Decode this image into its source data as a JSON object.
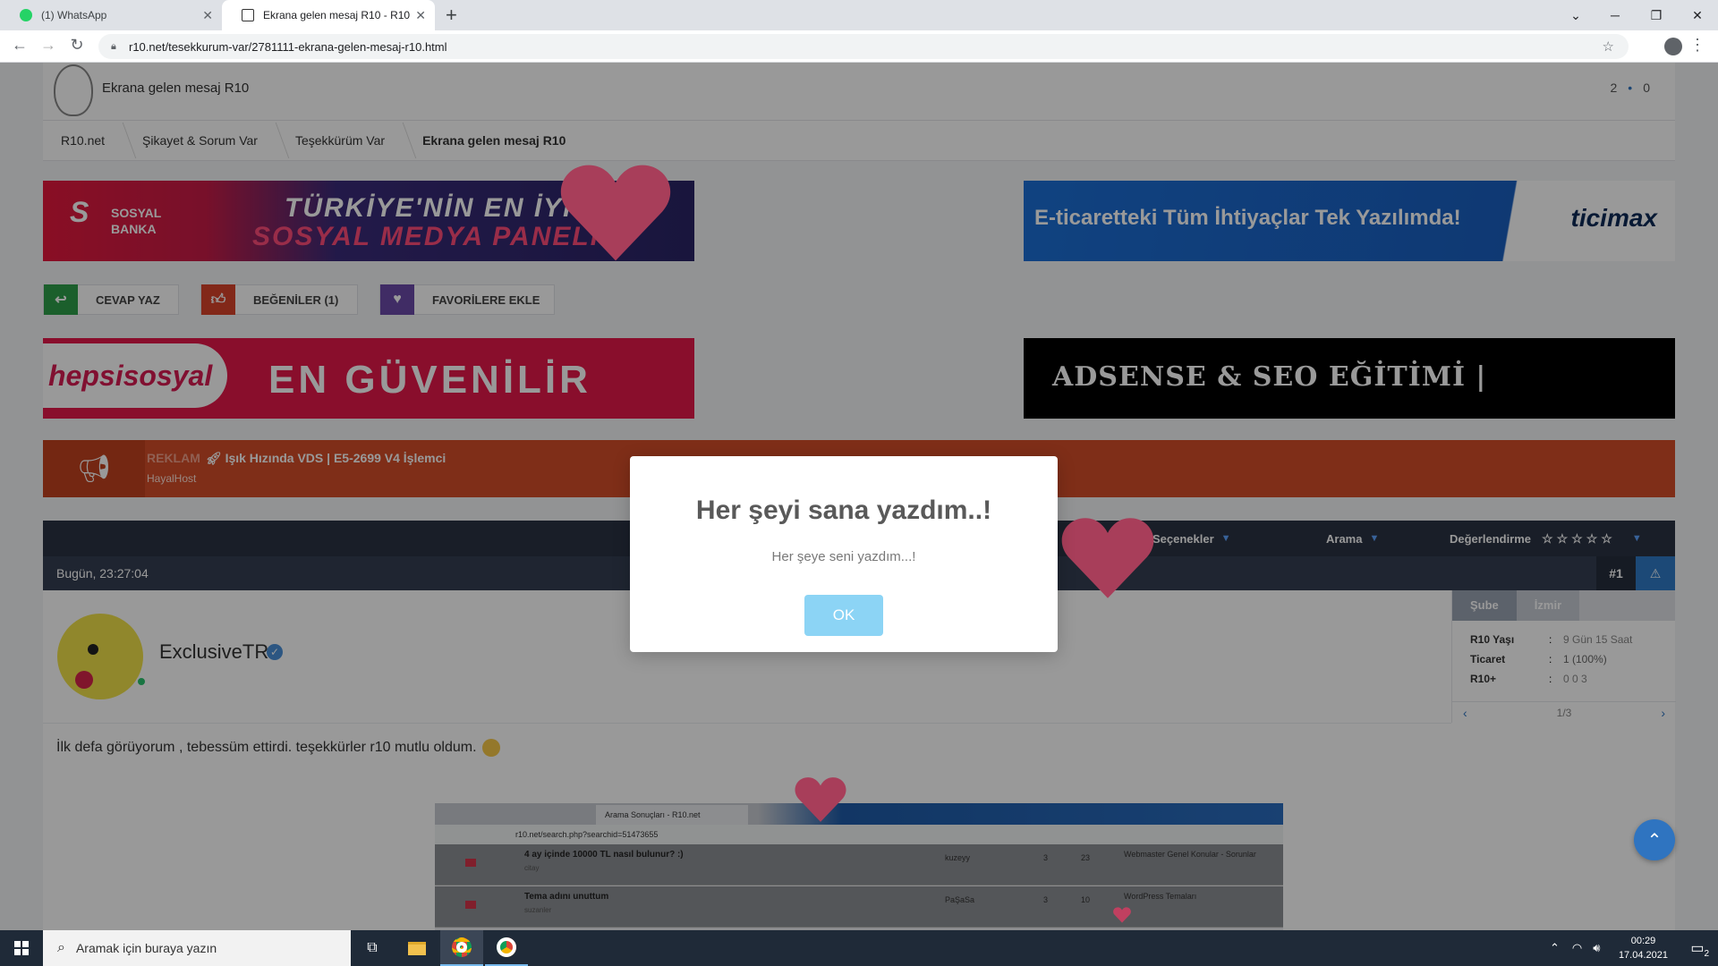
{
  "browser": {
    "tabs": [
      {
        "title": "(1) WhatsApp",
        "active": false
      },
      {
        "title": "Ekrana gelen mesaj R10 - R10.net",
        "active": true
      }
    ],
    "url": "r10.net/tesekkurum-var/2781111-ekrana-gelen-mesaj-r10.html"
  },
  "site": {
    "header_title": "Ekrana gelen mesaj R10",
    "counter_left": "2",
    "counter_right": "0",
    "breadcrumbs": [
      "R10.net",
      "Şikayet & Sorum Var",
      "Teşekkürüm Var",
      "Ekrana gelen mesaj R10"
    ]
  },
  "banners": {
    "sosyal": {
      "logo": "SOSYAL BANKA",
      "line1": "TÜRKİYE'NİN EN İYİ",
      "line2": "SOSYAL MEDYA PANELİ"
    },
    "ticimax": {
      "text": "E-ticaretteki Tüm İhtiyaçlar Tek Yazılımda!",
      "brand": "ticimax"
    },
    "hepsi": {
      "brand": "hepsisosyal",
      "slogan": "EN GÜVENİLİR"
    },
    "adsense": {
      "text": "ADSENSE & SEO EĞİTİMİ |"
    }
  },
  "actions": {
    "reply": "CEVAP YAZ",
    "likes": "BEĞENİLER (1)",
    "favorites": "FAVORİLERE EKLE"
  },
  "ad": {
    "tag": "REKLAM",
    "title": "Işık Hızında VDS | E5-2699 V4 İşlemci",
    "company": "HayalHost"
  },
  "thread_toolbar": {
    "options": "Seçenekler",
    "search": "Arama",
    "rating": "Değerlendirme",
    "rating_stars": 0
  },
  "post": {
    "date": "Bugün, 23:27:04",
    "number": "#1",
    "username": "ExclusiveTR",
    "text": "İlk defa görüyorum , tebessüm ettirdi. teşekkürler r10 mutlu oldum."
  },
  "user_panel": {
    "tabs": [
      "Şube",
      "İzmir"
    ],
    "rows": [
      {
        "key": "R10 Yaşı",
        "value": "9 Gün 15 Saat"
      },
      {
        "key": "Ticaret",
        "value": "1 (100%)"
      },
      {
        "key": "R10+",
        "value": "0   0   3"
      }
    ],
    "pager": "1/3"
  },
  "embedded_screenshot": {
    "tab": "Arama Sonuçları - R10.net",
    "url": "r10.net/search.php?searchid=51473655",
    "rows": [
      {
        "title": "4 ay içinde 10000 TL nasıl bulunur? :)",
        "user": "citay",
        "last": "kuzeyy",
        "replies": "3",
        "views": "23",
        "forum": "Webmaster Genel Konular - Sorunlar"
      },
      {
        "title": "Tema adını unuttum",
        "user": "suzanler",
        "last": "PaŞaSa",
        "replies": "3",
        "views": "10",
        "forum": "WordPress Temaları"
      }
    ]
  },
  "modal": {
    "title": "Her şeyi sana yazdım..!",
    "text": "Her şeye seni yazdım...!",
    "ok": "OK"
  },
  "taskbar": {
    "search_placeholder": "Aramak için buraya yazın",
    "time": "00:29",
    "date": "17.04.2021",
    "notifications": "2"
  },
  "colors": {
    "heart": "#a83e5a",
    "accent": "#2f74c0",
    "modal_ok": "#8cd4f5"
  }
}
